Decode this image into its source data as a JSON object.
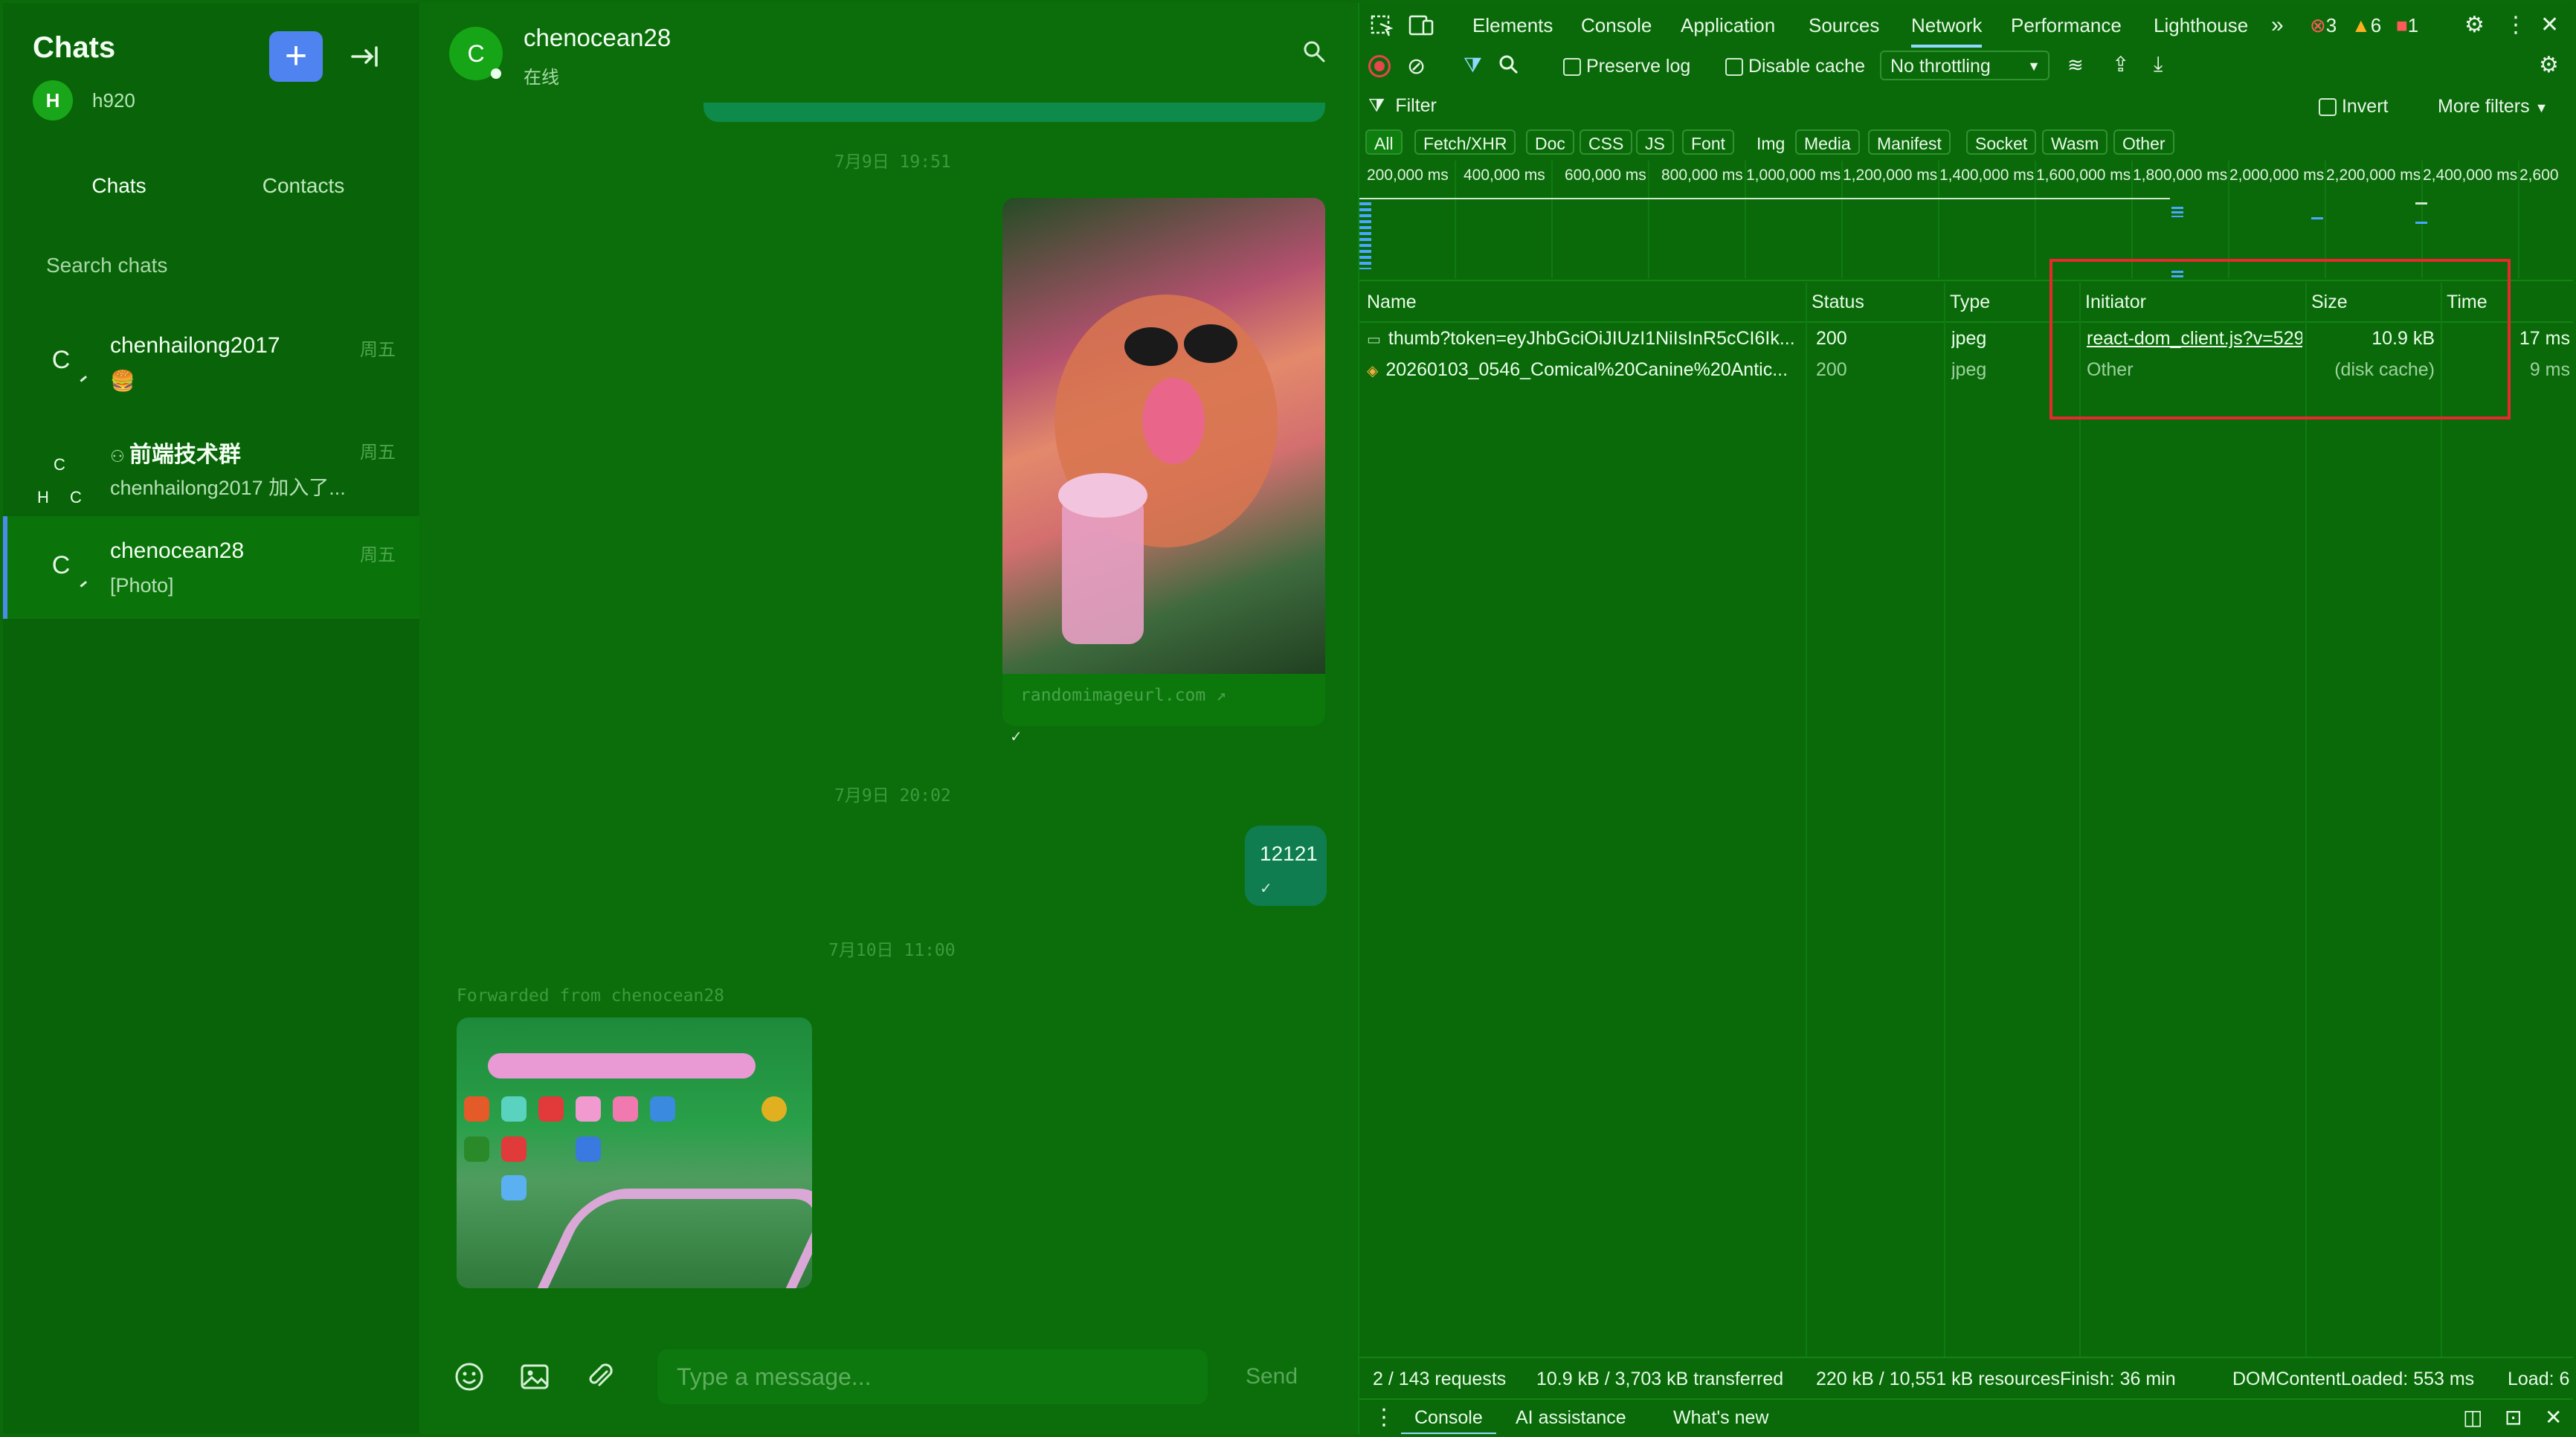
{
  "sidebar": {
    "title": "Chats",
    "user_avatar": "H",
    "user_name": "h920",
    "new_icon": "plus-icon",
    "logout_icon": "logout-icon",
    "tabs": [
      "Chats",
      "Contacts"
    ],
    "search_placeholder": "Search chats",
    "chats": [
      {
        "avatar": "C",
        "name": "chenhailong2017",
        "preview": "🍔",
        "time": "周五"
      },
      {
        "avatar": "",
        "group_avatars": [
          "C",
          "H",
          "C"
        ],
        "name": "前端技术群",
        "preview": "chenhailong2017 加入了...",
        "time": "周五"
      },
      {
        "avatar": "C",
        "name": "chenocean28",
        "preview": "[Photo]",
        "time": "周五"
      }
    ]
  },
  "chat": {
    "avatar": "C",
    "name": "chenocean28",
    "status": "在线",
    "timestamps": [
      "7月9日 19:51",
      "7月9日 20:02",
      "7月10日 11:00"
    ],
    "image_url_label": "randomimageurl.com",
    "check": "✓",
    "text_message": "12121",
    "forwarded_label": "Forwarded from chenocean28",
    "composer_placeholder": "Type a message...",
    "send_label": "Send"
  },
  "devtools": {
    "tabs": [
      "Elements",
      "Console",
      "Application",
      "Sources",
      "Network",
      "Performance",
      "Lighthouse"
    ],
    "active_tab": "Network",
    "more_tabs": "»",
    "errors": "3",
    "warnings": "6",
    "issues": "1",
    "preserve_log": "Preserve log",
    "disable_cache": "Disable cache",
    "throttling": "No throttling",
    "filter_placeholder": "Filter",
    "invert": "Invert",
    "more_filters": "More filters",
    "types": [
      "All",
      "Fetch/XHR",
      "Doc",
      "CSS",
      "JS",
      "Font",
      "Img",
      "Media",
      "Manifest",
      "Socket",
      "Wasm",
      "Other"
    ],
    "overview_ticks": [
      "200,000 ms",
      "400,000 ms",
      "600,000 ms",
      "800,000 ms",
      "1,000,000 ms",
      "1,200,000 ms",
      "1,400,000 ms",
      "1,600,000 ms",
      "1,800,000 ms",
      "2,000,000 ms",
      "2,200,000 ms",
      "2,400,000 ms",
      "2,600"
    ],
    "columns": {
      "name": "Name",
      "status": "Status",
      "type": "Type",
      "initiator": "Initiator",
      "size": "Size",
      "time": "Time"
    },
    "rows": [
      {
        "name": "thumb?token=eyJhbGciOiJIUzI1NiIsInR5cCI6Ik...",
        "status": "200",
        "type": "jpeg",
        "initiator": "react-dom_client.js?v=529",
        "size": "10.9 kB",
        "time": "17 ms"
      },
      {
        "name": "20260103_0546_Comical%20Canine%20Antic...",
        "status": "200",
        "type": "jpeg",
        "initiator": "Other",
        "size": "(disk cache)",
        "time": "9 ms"
      }
    ],
    "summary": {
      "requests": "2 / 143 requests",
      "transferred": "10.9 kB / 3,703 kB transferred",
      "resources": "220 kB / 10,551 kB resources",
      "finish": "Finish: 36 min",
      "dcl": "DOMContentLoaded: 553 ms",
      "load": "Load: 6"
    },
    "drawer_tabs": [
      "Console",
      "AI assistance",
      "What's new"
    ],
    "colors": {
      "highlight": "#e8282e",
      "accent": "#8fd9ff",
      "record": "#e8454c"
    }
  }
}
